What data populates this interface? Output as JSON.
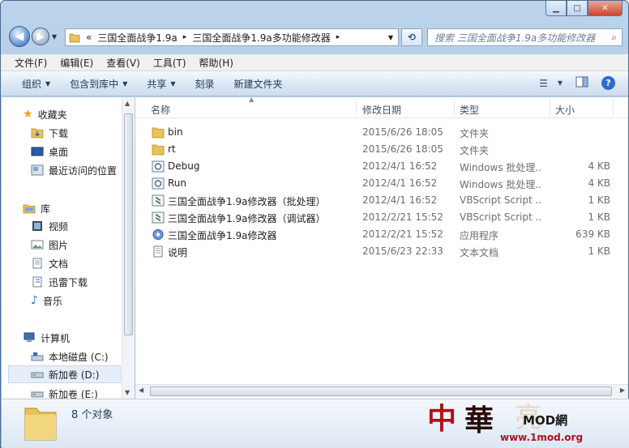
{
  "window": {
    "caption": {
      "minimize": "▁",
      "maximize": "□",
      "close": "✕"
    }
  },
  "address": {
    "chevron": "«",
    "crumbs": [
      "三国全面战争1.9a",
      "三国全面战争1.9a多功能修改器"
    ],
    "sep": "▸"
  },
  "search": {
    "placeholder": "搜索 三国全面战争1.9a多功能修改器"
  },
  "menu": [
    "文件(F)",
    "编辑(E)",
    "查看(V)",
    "工具(T)",
    "帮助(H)"
  ],
  "toolbar": {
    "organize": "组织",
    "include": "包含到库中",
    "share": "共享",
    "burn": "刻录",
    "new_folder": "新建文件夹"
  },
  "sidebar": {
    "favorites_header": "收藏夹",
    "favorites": [
      "下载",
      "桌面",
      "最近访问的位置"
    ],
    "libraries_header": "库",
    "libraries": [
      "视频",
      "图片",
      "文档",
      "迅雷下载",
      "音乐"
    ],
    "computer_header": "计算机",
    "drives": [
      "本地磁盘 (C:)",
      "新加卷 (D:)",
      "新加卷 (E:)"
    ]
  },
  "columns": {
    "name": "名称",
    "date": "修改日期",
    "type": "类型",
    "size": "大小"
  },
  "files": [
    {
      "name": "bin",
      "date": "2015/6/26 18:05",
      "type": "文件夹",
      "size": "",
      "icon": "folder-icon"
    },
    {
      "name": "rt",
      "date": "2015/6/26 18:05",
      "type": "文件夹",
      "size": "",
      "icon": "folder-icon"
    },
    {
      "name": "Debug",
      "date": "2012/4/1 16:52",
      "type": "Windows 批处理...",
      "size": "4 KB",
      "icon": "batch-file-icon"
    },
    {
      "name": "Run",
      "date": "2012/4/1 16:52",
      "type": "Windows 批处理...",
      "size": "4 KB",
      "icon": "batch-file-icon"
    },
    {
      "name": "三国全面战争1.9a修改器（批处理）",
      "date": "2012/4/1 16:52",
      "type": "VBScript Script ...",
      "size": "1 KB",
      "icon": "vbscript-icon"
    },
    {
      "name": "三国全面战争1.9a修改器（调试器）",
      "date": "2012/2/21 15:52",
      "type": "VBScript Script ...",
      "size": "1 KB",
      "icon": "vbscript-icon"
    },
    {
      "name": "三国全面战争1.9a修改器",
      "date": "2012/2/21 15:52",
      "type": "应用程序",
      "size": "639 KB",
      "icon": "application-gear-icon"
    },
    {
      "name": "说明",
      "date": "2015/6/23 22:33",
      "type": "文本文档",
      "size": "1 KB",
      "icon": "text-file-icon"
    }
  ],
  "status": {
    "count": "8 个对象"
  },
  "watermark": {
    "text": "MOD網",
    "url": "www.1mod.org"
  }
}
